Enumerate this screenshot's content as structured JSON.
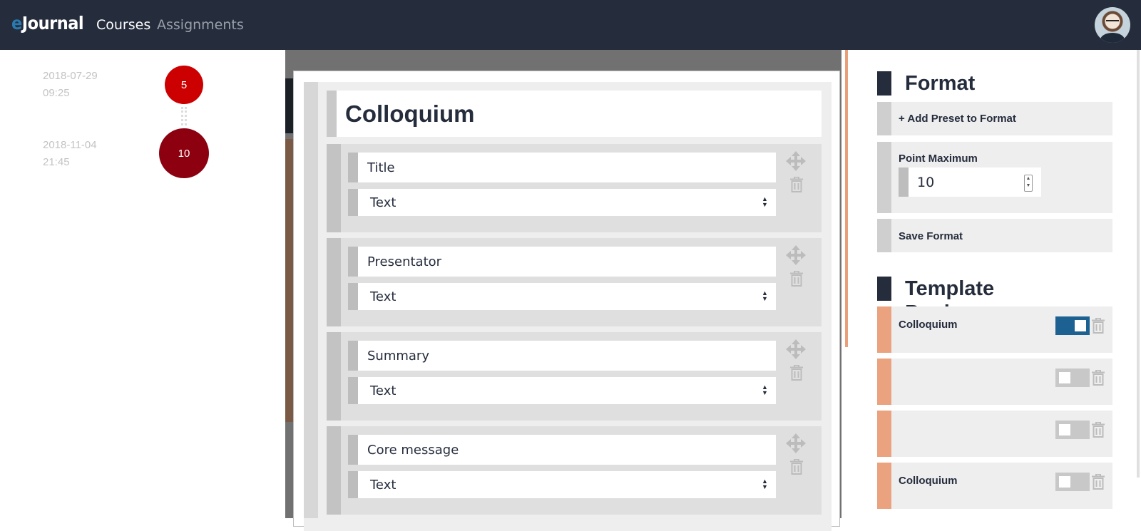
{
  "navbar": {
    "brand_prefix": "e",
    "brand_rest": "Journal",
    "links": [
      "Courses",
      "Assignments"
    ]
  },
  "timeline": [
    {
      "date": "2018-07-29",
      "time": "09:25",
      "count": "5",
      "color": "#cc0000"
    },
    {
      "date": "2018-11-04",
      "time": "21:45",
      "count": "10",
      "color": "#8c0010"
    }
  ],
  "template_editor": {
    "title": "Colloquium",
    "fields": [
      {
        "name": "Title",
        "type": "Text"
      },
      {
        "name": "Presentator",
        "type": "Text"
      },
      {
        "name": "Summary",
        "type": "Text"
      },
      {
        "name": "Core message",
        "type": "Text"
      }
    ]
  },
  "format_panel": {
    "heading": "Format",
    "add_preset_label": "+ Add Preset to Format",
    "point_max_label": "Point Maximum",
    "point_max_value": "10",
    "save_label": "Save Format"
  },
  "template_pool": {
    "heading": "Template Pool",
    "items": [
      {
        "name": "Colloquium",
        "active": true
      },
      {
        "name": "",
        "active": false
      },
      {
        "name": "",
        "active": false
      },
      {
        "name": "Colloquium",
        "active": false
      }
    ]
  },
  "colors": {
    "navbar": "#252c3c",
    "accent_blue": "#1c6191",
    "pool_accent": "#eaa37e"
  }
}
